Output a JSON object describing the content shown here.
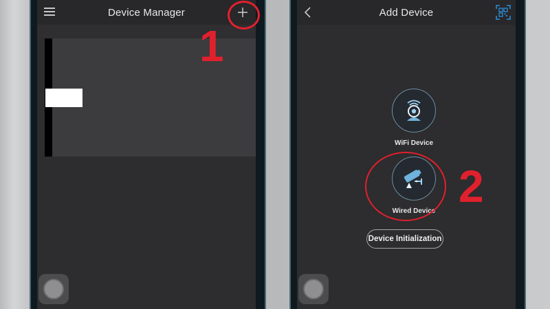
{
  "left_screen": {
    "title": "Device Manager",
    "menu_icon": "menu-icon",
    "add_icon": "plus-icon"
  },
  "right_screen": {
    "title": "Add Device",
    "back_icon": "chevron-left-icon",
    "qr_icon": "qr-scan-icon",
    "wifi_device_label": "WiFi Device",
    "wired_device_label": "Wired Device",
    "device_init_label": "Device Initialization"
  },
  "annotations": {
    "step_1": "1",
    "step_2": "2",
    "highlight_color": "#e0212d"
  },
  "colors": {
    "screen_bg": "#2d2c2e",
    "accent_blue": "#6fb2dc",
    "qr_blue": "#2a8fd6"
  }
}
